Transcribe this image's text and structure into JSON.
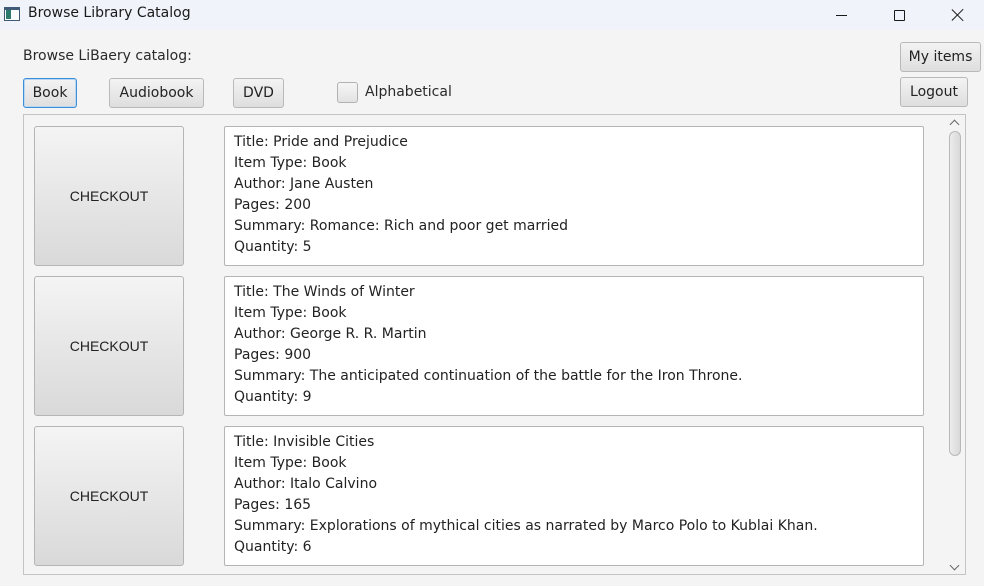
{
  "window": {
    "title": "Browse Library Catalog"
  },
  "header": {
    "catalog_label": "Browse LiBaery catalog:",
    "filters": {
      "book": "Book",
      "audiobook": "Audiobook",
      "dvd": "DVD",
      "alphabetical_label": "Alphabetical",
      "alphabetical_checked": false,
      "selected": "Book"
    },
    "my_items_label": "My items",
    "logout_label": "Logout"
  },
  "items": [
    {
      "checkout_label": "CHECKOUT",
      "title": "Title: Pride and Prejudice",
      "item_type": "Item Type: Book",
      "author": "Author: Jane Austen",
      "pages": "Pages: 200",
      "summary": "Summary: Romance: Rich and poor get married",
      "quantity": "Quantity: 5"
    },
    {
      "checkout_label": "CHECKOUT",
      "title": "Title: The Winds of Winter",
      "item_type": "Item Type: Book",
      "author": "Author: George R. R. Martin",
      "pages": "Pages: 900",
      "summary": "Summary: The anticipated continuation of the battle for the Iron Throne.",
      "quantity": "Quantity: 9"
    },
    {
      "checkout_label": "CHECKOUT",
      "title": "Title: Invisible Cities",
      "item_type": "Item Type: Book",
      "author": "Author: Italo Calvino",
      "pages": "Pages: 165",
      "summary": "Summary: Explorations of mythical cities as narrated by Marco Polo to Kublai Khan.",
      "quantity": "Quantity: 6"
    }
  ],
  "colors": {
    "focus_border": "#3d8ed8",
    "background": "#f4f4f4",
    "titlebar": "#f0f3f9"
  }
}
